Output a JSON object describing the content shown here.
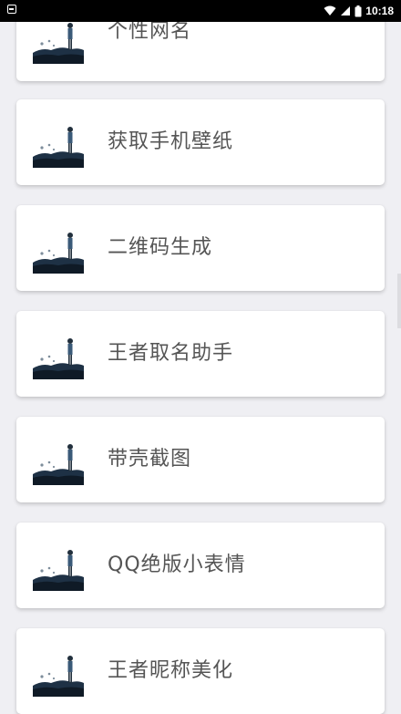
{
  "status_bar": {
    "time": "10:18",
    "icons": [
      "notification-icon",
      "wifi-icon",
      "signal-icon",
      "battery-icon"
    ]
  },
  "menu": {
    "items": [
      {
        "label": "个性网名",
        "icon": "thumbnail-image"
      },
      {
        "label": "获取手机壁纸",
        "icon": "thumbnail-image"
      },
      {
        "label": "二维码生成",
        "icon": "thumbnail-image"
      },
      {
        "label": "王者取名助手",
        "icon": "thumbnail-image"
      },
      {
        "label": "带壳截图",
        "icon": "thumbnail-image"
      },
      {
        "label": "QQ绝版小表情",
        "icon": "thumbnail-image"
      },
      {
        "label": "王者昵称美化",
        "icon": "thumbnail-image"
      }
    ]
  },
  "colors": {
    "background": "#efeff3",
    "card": "#ffffff",
    "text": "#555555"
  }
}
